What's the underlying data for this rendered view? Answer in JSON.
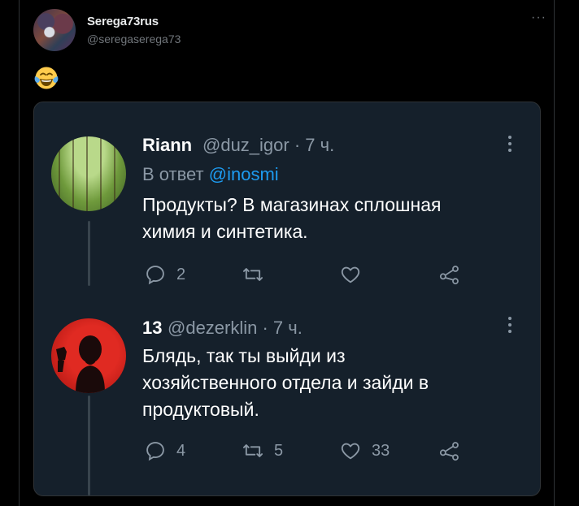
{
  "outer_tweet": {
    "author_name": "Serega73rus",
    "handle": "@seregaserega73",
    "more_label": "···",
    "text_emoji": "face-with-tears-of-joy"
  },
  "embedded_thread": {
    "tweets": [
      {
        "name": "Riann",
        "handle": "@duz_igor · 7 ч.",
        "reply_prefix": "В ответ",
        "reply_to": "@inosmi",
        "text_lines": [
          "Продукты?  В магазинах сплошная",
          "химия и синтетика."
        ],
        "replies": "2",
        "retweets": "",
        "likes": ""
      },
      {
        "name": "13",
        "handle": "@dezerklin · 7 ч.",
        "text_lines": [
          "Блядь, так ты выйди из",
          "хозяйственного отдела и зайди в",
          "продуктовый."
        ],
        "replies": "4",
        "retweets": "5",
        "likes": "33"
      }
    ]
  },
  "colors": {
    "page_bg": "#000000",
    "card_bg": "#15202b",
    "accent_link": "#1d9bf0",
    "muted_text": "#8b98a5"
  }
}
